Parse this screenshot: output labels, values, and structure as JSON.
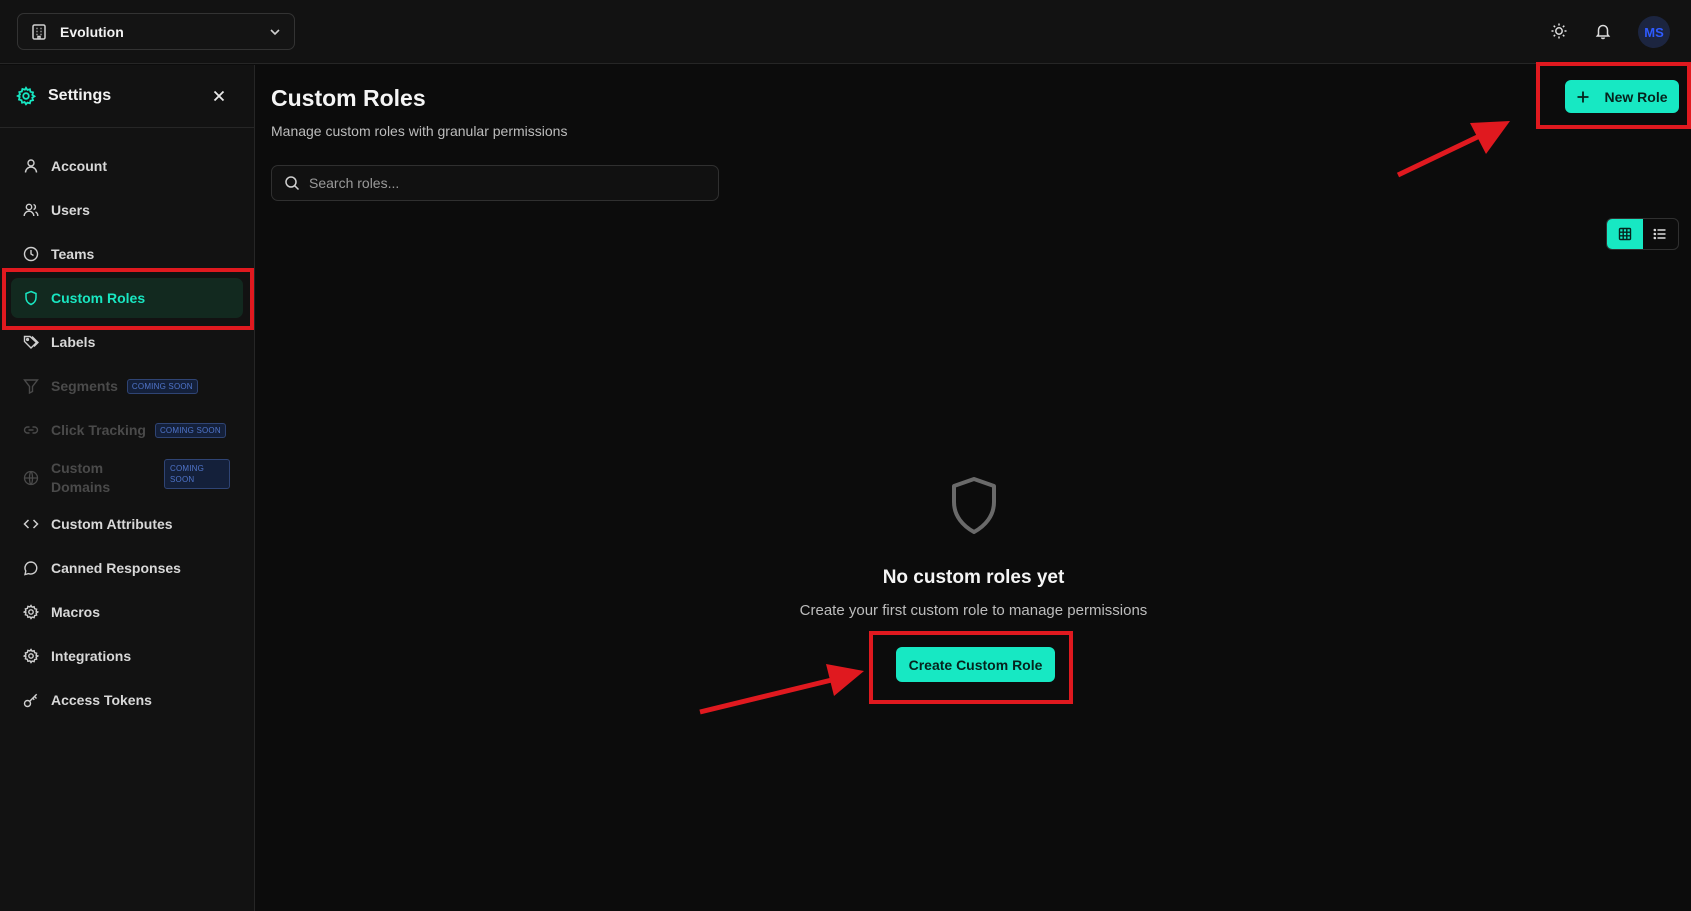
{
  "topbar": {
    "workspace_name": "Evolution",
    "icons": [
      "building-icon",
      "chevron-down-icon",
      "sun-icon",
      "bell-icon"
    ],
    "avatar_initials": "MS"
  },
  "sidebar": {
    "title": "Settings",
    "items": [
      {
        "label": "Account",
        "icon": "user-icon",
        "state": "normal"
      },
      {
        "label": "Users",
        "icon": "users-icon",
        "state": "normal"
      },
      {
        "label": "Teams",
        "icon": "clock-icon",
        "state": "normal"
      },
      {
        "label": "Custom Roles",
        "icon": "shield-icon",
        "state": "active"
      },
      {
        "label": "Labels",
        "icon": "tag-icon",
        "state": "normal"
      },
      {
        "label": "Segments",
        "icon": "filter-icon",
        "state": "disabled",
        "badge": "COMING SOON"
      },
      {
        "label": "Click Tracking",
        "icon": "link-icon",
        "state": "disabled",
        "badge": "COMING SOON"
      },
      {
        "label_line1": "Custom",
        "label_line2": "Domains",
        "icon": "globe-icon",
        "state": "disabled",
        "badge_line1": "COMING",
        "badge_line2": "SOON"
      },
      {
        "label": "Custom Attributes",
        "icon": "code-icon",
        "state": "normal"
      },
      {
        "label": "Canned Responses",
        "icon": "message-icon",
        "state": "normal"
      },
      {
        "label": "Macros",
        "icon": "gear-icon",
        "state": "normal"
      },
      {
        "label": "Integrations",
        "icon": "gear-icon",
        "state": "normal"
      },
      {
        "label": "Access Tokens",
        "icon": "key-icon",
        "state": "normal"
      }
    ]
  },
  "main": {
    "title": "Custom Roles",
    "subtitle": "Manage custom roles with granular permissions",
    "search_placeholder": "Search roles...",
    "new_role_label": "New Role",
    "view_modes": [
      "grid",
      "list"
    ],
    "active_view": "grid",
    "empty_title": "No custom roles yet",
    "empty_subtitle": "Create your first custom role to manage permissions",
    "create_button_label": "Create Custom Role"
  },
  "colors": {
    "accent": "#17e8c3",
    "background": "#0c0c0c",
    "panel": "#121212",
    "annotation_red": "#e0191f"
  }
}
